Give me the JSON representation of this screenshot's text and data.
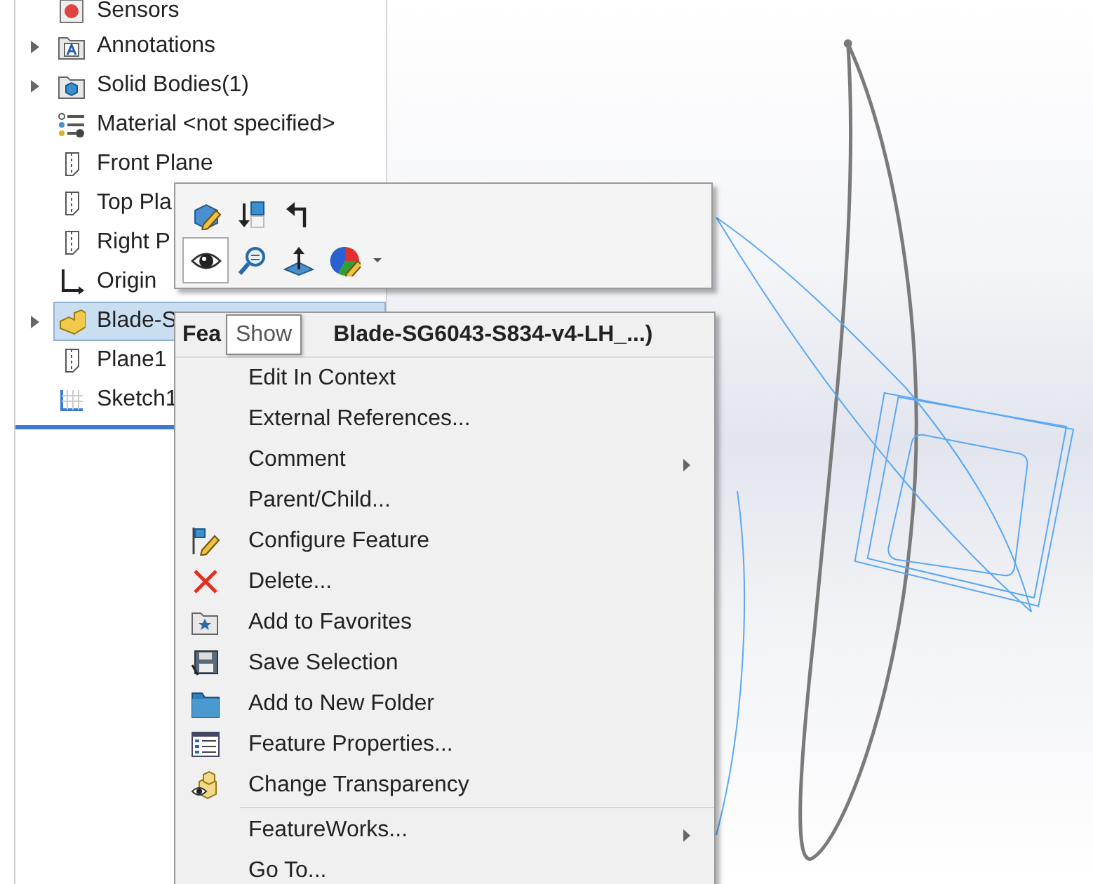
{
  "feature_tree": {
    "items": [
      {
        "label": "Sensors",
        "kind": "sensors",
        "collapsed": false,
        "selected": false
      },
      {
        "label": "Annotations",
        "kind": "annotations",
        "collapsed": true,
        "selected": false
      },
      {
        "label": "Solid Bodies(1)",
        "kind": "bodies",
        "collapsed": true,
        "selected": false
      },
      {
        "label": "Material <not specified>",
        "kind": "material",
        "collapsed": false,
        "selected": false
      },
      {
        "label": "Front Plane",
        "kind": "plane",
        "collapsed": false,
        "selected": false
      },
      {
        "label": "Top Pla",
        "kind": "plane",
        "collapsed": false,
        "selected": false
      },
      {
        "label": "Right P",
        "kind": "plane",
        "collapsed": false,
        "selected": false
      },
      {
        "label": "Origin",
        "kind": "origin",
        "collapsed": false,
        "selected": false
      },
      {
        "label": "Blade-S",
        "kind": "part",
        "collapsed": true,
        "selected": true
      },
      {
        "label": "Plane1",
        "kind": "plane",
        "collapsed": false,
        "selected": false
      },
      {
        "label": "Sketch1",
        "kind": "sketch",
        "collapsed": false,
        "selected": false
      }
    ]
  },
  "toolbar": {
    "rows": [
      [
        {
          "kind": "edit-part",
          "highlighted": false
        },
        {
          "kind": "rollback",
          "highlighted": false
        },
        {
          "kind": "back",
          "highlighted": false
        }
      ],
      [
        {
          "kind": "show",
          "highlighted": true
        },
        {
          "kind": "zoom",
          "highlighted": false
        },
        {
          "kind": "normal-to",
          "highlighted": false
        },
        {
          "kind": "appearance",
          "highlighted": false
        },
        {
          "kind": "caret"
        }
      ]
    ]
  },
  "tooltip": {
    "text": "Show"
  },
  "context_menu": {
    "title_parts": [
      "Fea",
      "Blade-SG6043-S834-v4-LH_...)"
    ],
    "items": [
      {
        "kind": "plain",
        "label": "Edit In Context",
        "submenu": false
      },
      {
        "kind": "plain",
        "label": "External References...",
        "submenu": false
      },
      {
        "kind": "plain",
        "label": "Comment",
        "submenu": true
      },
      {
        "kind": "plain",
        "label": "Parent/Child...",
        "submenu": false
      },
      {
        "kind": "configure",
        "label": "Configure Feature",
        "submenu": false
      },
      {
        "kind": "delete",
        "label": "Delete...",
        "submenu": false
      },
      {
        "kind": "favorites",
        "label": "Add to Favorites",
        "submenu": false
      },
      {
        "kind": "save",
        "label": "Save Selection",
        "submenu": false
      },
      {
        "kind": "folder",
        "label": "Add to New Folder",
        "submenu": false
      },
      {
        "kind": "properties",
        "label": "Feature Properties...",
        "submenu": false
      },
      {
        "kind": "transparency",
        "label": "Change Transparency",
        "submenu": false
      },
      {
        "kind": "separator"
      },
      {
        "kind": "plain",
        "label": "FeatureWorks...",
        "submenu": true
      },
      {
        "kind": "plain",
        "label": "Go To...",
        "submenu": false
      }
    ]
  }
}
